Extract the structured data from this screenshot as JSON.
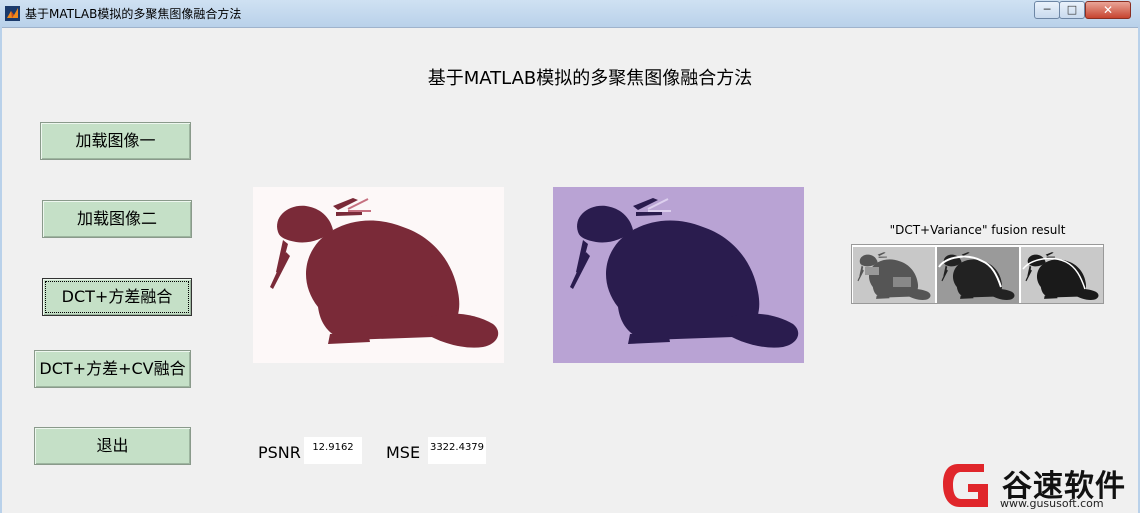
{
  "window": {
    "title": "基于MATLAB模拟的多聚焦图像融合方法",
    "controls": {
      "minimize": "─",
      "maximize": "□",
      "close": "✕"
    }
  },
  "main": {
    "title": "基于MATLAB模拟的多聚焦图像融合方法",
    "buttons": {
      "load1": "加载图像一",
      "load2": "加载图像二",
      "dct_var": "DCT+方差融合",
      "dct_var_cv": "DCT+方差+CV融合",
      "exit": "退出"
    },
    "result": {
      "label": "\"DCT+Variance\" fusion result"
    },
    "metrics": {
      "psnr_label": "PSNR",
      "psnr_value": "12.9162",
      "mse_label": "MSE",
      "mse_value": "3322.4379"
    }
  },
  "watermark": {
    "name": "谷速软件",
    "url": "www.gususoft.com"
  },
  "colors": {
    "button_bg": "#c5e0c7",
    "image1_tint": "#7a2a38",
    "image2_bg": "#b9a3d4",
    "image2_tint": "#2a1c4e",
    "logo_red": "#e0262b"
  },
  "icons": {
    "app": "matlab-icon"
  }
}
